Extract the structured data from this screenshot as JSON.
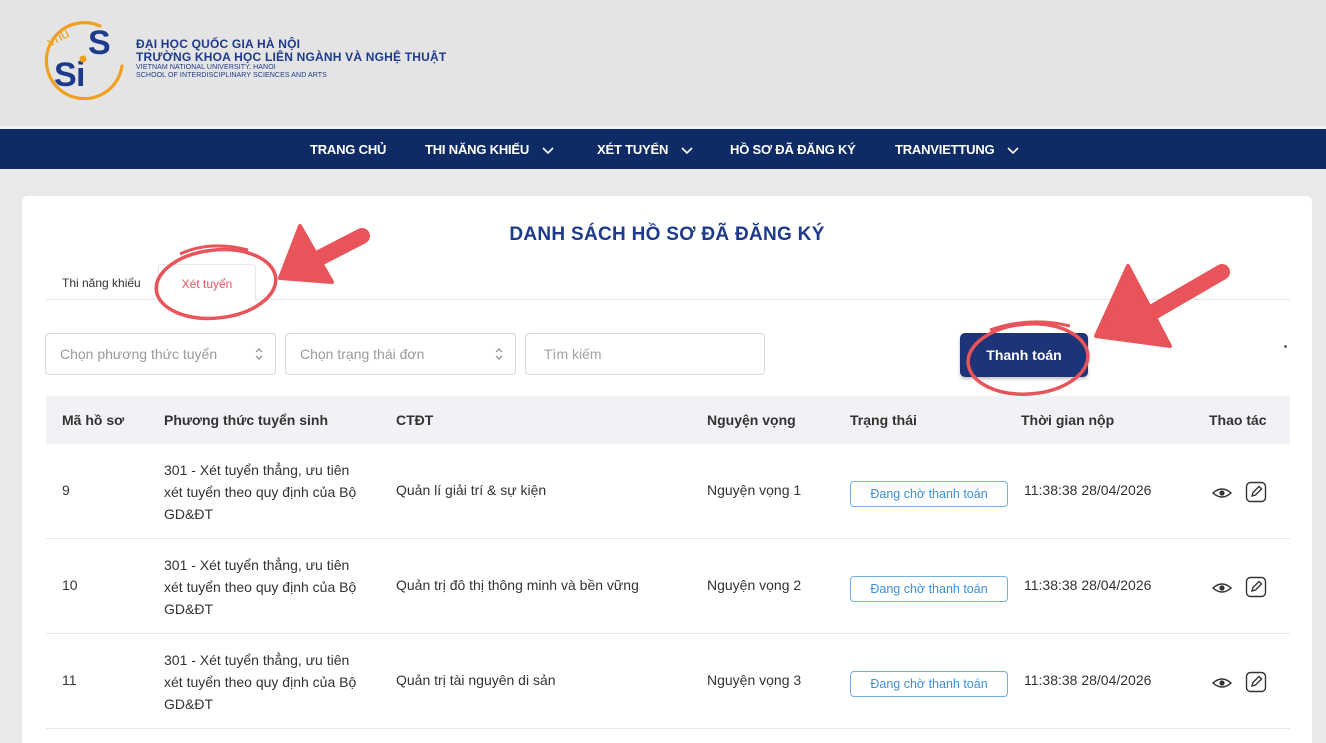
{
  "header": {
    "logo_text": "VNU SIS",
    "school_lines": [
      "ĐẠI HỌC QUỐC GIA HÀ NỘI",
      "TRƯỜNG KHOA HỌC LIÊN NGÀNH VÀ NGHỆ THUẬT",
      "VIETNAM NATIONAL UNIVERSITY, HANOI",
      "SCHOOL OF INTERDISCIPLINARY SCIENCES AND ARTS"
    ]
  },
  "nav": {
    "items": [
      {
        "label": "TRANG CHỦ",
        "dropdown": false
      },
      {
        "label": "THI NĂNG KHIẾU",
        "dropdown": true
      },
      {
        "label": "XÉT TUYỂN",
        "dropdown": true
      },
      {
        "label": "HỒ SƠ ĐÃ ĐĂNG KÝ",
        "dropdown": false
      },
      {
        "label": "TRANVIETTUNG",
        "dropdown": true
      }
    ]
  },
  "page": {
    "title": "DANH SÁCH HỒ SƠ ĐÃ ĐĂNG KÝ",
    "tabs": [
      {
        "label": "Thi năng khiếu",
        "active": false
      },
      {
        "label": "Xét tuyển",
        "active": true
      }
    ],
    "filters": {
      "method_select": "Chọn phương thức tuyển",
      "status_select": "Chọn trạng thái đơn",
      "search_placeholder": "Tìm kiếm"
    },
    "pay_button": "Thanh toán"
  },
  "table": {
    "headers": [
      "Mã hồ sơ",
      "Phương thức tuyển sinh",
      "CTĐT",
      "Nguyện vọng",
      "Trạng thái",
      "Thời gian nộp",
      "Thao tác"
    ],
    "rows": [
      {
        "id": "9",
        "method": "301 - Xét tuyển thẳng, ưu tiên xét tuyển theo quy định của Bộ GD&ĐT",
        "program": "Quản lí giải trí & sự kiện",
        "wish": "Nguyện vọng 1",
        "status": "Đang chờ thanh toán",
        "time": "11:38:38 28/04/2026"
      },
      {
        "id": "10",
        "method": "301 - Xét tuyển thẳng, ưu tiên xét tuyển theo quy định của Bộ GD&ĐT",
        "program": "Quản trị đô thị thông minh và bền vững",
        "wish": "Nguyện vọng 2",
        "status": "Đang chờ thanh toán",
        "time": "11:38:38 28/04/2026"
      },
      {
        "id": "11",
        "method": "301 - Xét tuyển thẳng, ưu tiên xét tuyển theo quy định của Bộ GD&ĐT",
        "program": "Quản trị tài nguyên di sản",
        "wish": "Nguyện vọng 3",
        "status": "Đang chờ thanh toán",
        "time": "11:38:38 28/04/2026"
      }
    ]
  },
  "colors": {
    "navy": "#0f2b66",
    "button": "#1e3478",
    "accent_red": "#e8545a",
    "badge_blue": "#3d8fd6",
    "logo_orange": "#f0a020"
  }
}
